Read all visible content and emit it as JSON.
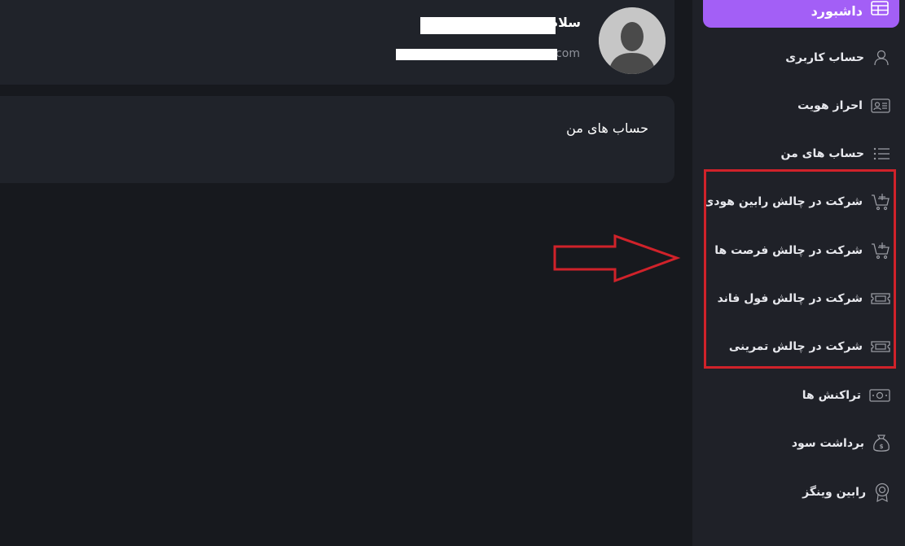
{
  "profile": {
    "greeting": "سلام",
    "email_suffix": "com"
  },
  "accounts_card": {
    "title": "حساب های من"
  },
  "sidebar": {
    "dashboard": {
      "label": "داشبورد",
      "icon": "table-icon"
    },
    "items": [
      {
        "label": "حساب کاربری",
        "icon": "user-icon"
      },
      {
        "label": "احراز هویت",
        "icon": "id-card-icon"
      },
      {
        "label": "حساب های من",
        "icon": "list-icon"
      },
      {
        "label": "شرکت در چالش رابین هودی",
        "icon": "cart-plus-icon"
      },
      {
        "label": "شرکت در چالش فرصت ها",
        "icon": "cart-plus-icon"
      },
      {
        "label": "شرکت در چالش فول فاند",
        "icon": "ticket-icon"
      },
      {
        "label": "شرکت در چالش تمرینی",
        "icon": "ticket-icon"
      },
      {
        "label": "تراکنش ها",
        "icon": "money-icon"
      },
      {
        "label": "برداشت سود",
        "icon": "money-bag-icon"
      },
      {
        "label": "رابین وینگز",
        "icon": "badge-icon"
      }
    ]
  },
  "colors": {
    "background": "#17191e",
    "card": "#20232a",
    "sidebar": "#1f2128",
    "accent": "#a35ff6",
    "highlight": "#d0222a"
  }
}
